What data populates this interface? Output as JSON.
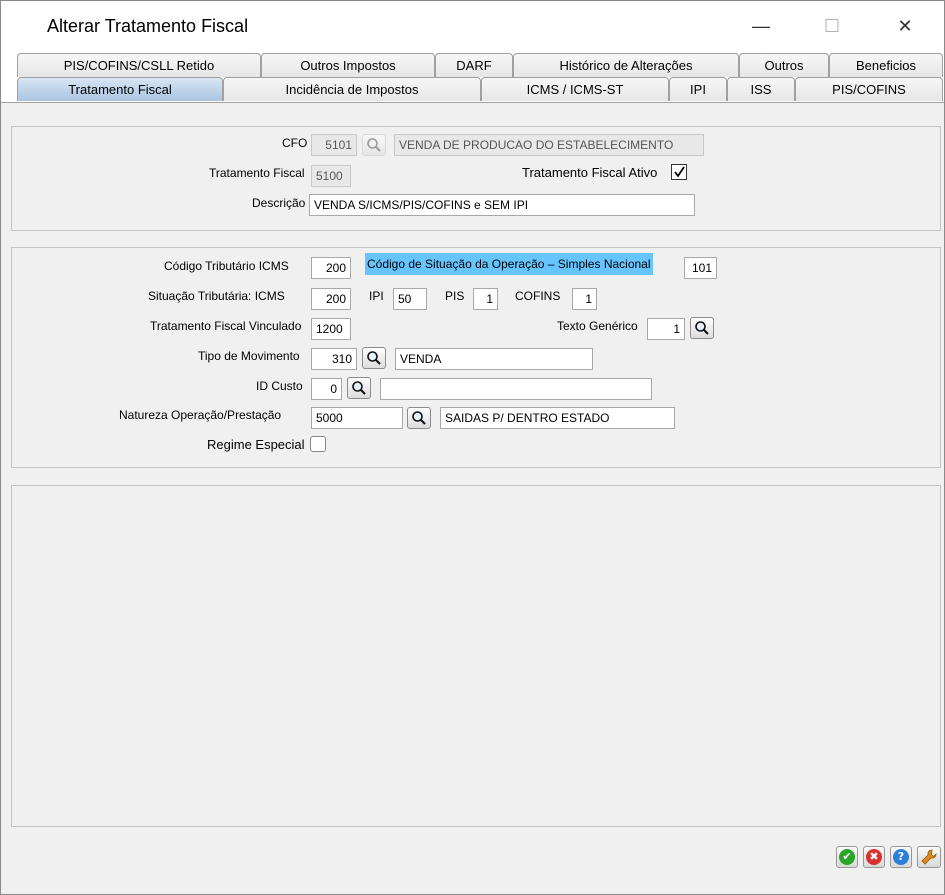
{
  "window": {
    "title": "Alterar Tratamento Fiscal",
    "minimize_glyph": "—",
    "maximize_glyph": "☐",
    "close_glyph": "✕"
  },
  "tabs_row1": [
    {
      "label": "PIS/COFINS/CSLL Retido"
    },
    {
      "label": "Outros Impostos"
    },
    {
      "label": "DARF"
    },
    {
      "label": "Histórico de Alterações"
    },
    {
      "label": "Outros"
    },
    {
      "label": "Beneficios"
    }
  ],
  "tabs_row2": [
    {
      "label": "Tratamento Fiscal",
      "active": true
    },
    {
      "label": "Incidência de Impostos"
    },
    {
      "label": "ICMS / ICMS-ST"
    },
    {
      "label": "IPI"
    },
    {
      "label": "ISS"
    },
    {
      "label": "PIS/COFINS"
    }
  ],
  "cfo": {
    "label": "CFO",
    "code": "5101",
    "description": "VENDA DE PRODUCAO DO ESTABELECIMENTO",
    "lookup_icon": "search-icon"
  },
  "tratamento_fiscal": {
    "label": "Tratamento Fiscal",
    "value": "5100"
  },
  "tratamento_fiscal_ativo": {
    "label": "Tratamento Fiscal Ativo",
    "checked": true
  },
  "descricao": {
    "label": "Descrição",
    "value": "VENDA S/ICMS/PIS/COFINS e SEM IPI"
  },
  "codigo_tributario_icms": {
    "label": "Código Tributário ICMS",
    "value": "200"
  },
  "csosn": {
    "label": "Código de Situação da Operação – Simples Nacional",
    "value": "101",
    "highlight_color": "#66c4ff"
  },
  "situacao_tributaria": {
    "label": "Situação Tributária: ICMS",
    "icms_value": "200",
    "ipi_label": "IPI",
    "ipi_value": "50",
    "pis_label": "PIS",
    "pis_value": "1",
    "cofins_label": "COFINS",
    "cofins_value": "1"
  },
  "tratamento_fiscal_vinculado": {
    "label": "Tratamento Fiscal Vinculado",
    "value": "1200"
  },
  "texto_generico": {
    "label": "Texto Genérico",
    "value": "1"
  },
  "tipo_movimento": {
    "label": "Tipo de Movimento",
    "code": "310",
    "description": "VENDA"
  },
  "id_custo": {
    "label": "ID Custo",
    "code": "0",
    "description": ""
  },
  "natureza_operacao": {
    "label": "Natureza Operação/Prestação",
    "code": "5000",
    "description": "SAIDAS P/ DENTRO ESTADO"
  },
  "regime_especial": {
    "label": "Regime Especial",
    "checked": false
  },
  "actions": [
    {
      "name": "confirm-button",
      "icon": "check-icon",
      "color": "#2aa52a",
      "glyph": "✔"
    },
    {
      "name": "cancel-button",
      "icon": "close-icon",
      "color": "#d93030",
      "glyph": "✖"
    },
    {
      "name": "help-button",
      "icon": "help-icon",
      "color": "#2a7fd9",
      "glyph": "?"
    },
    {
      "name": "tools-button",
      "icon": "wrench-icon",
      "color": "#e08a1e",
      "glyph": "🔧"
    }
  ]
}
